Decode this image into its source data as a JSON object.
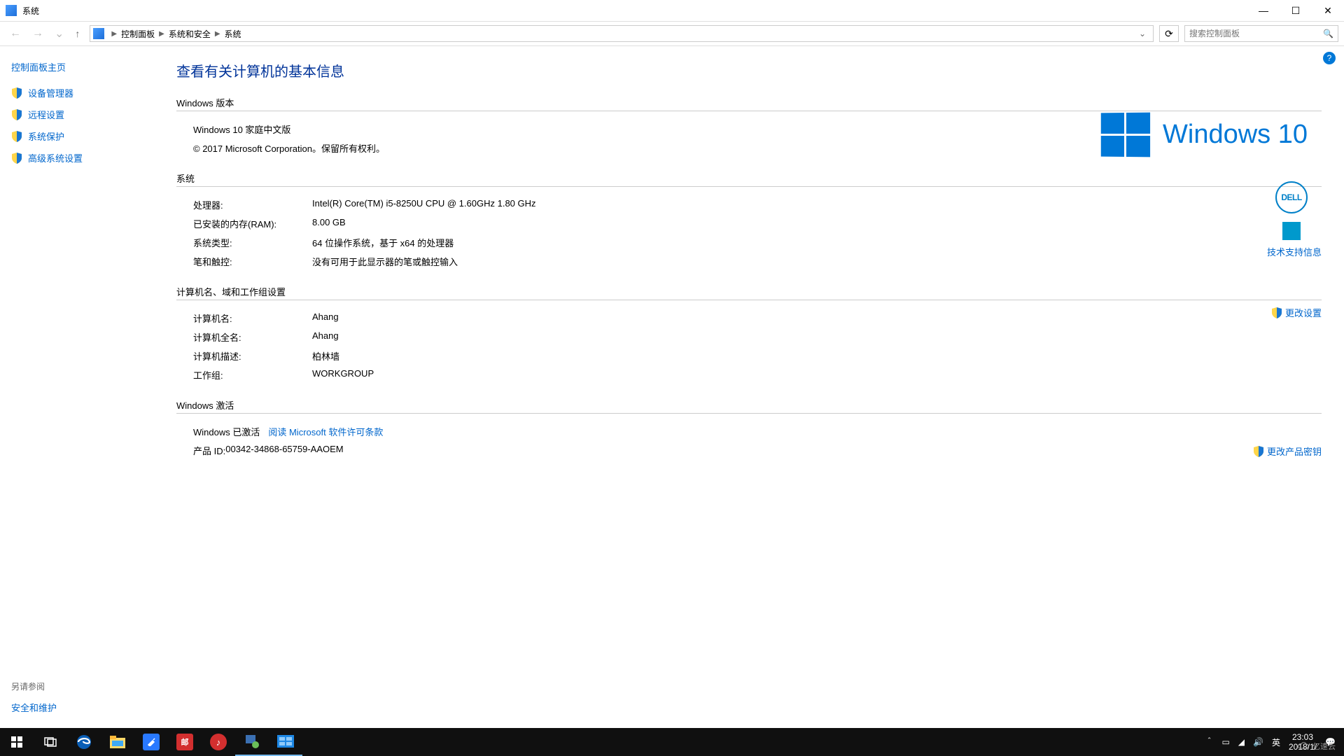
{
  "window": {
    "title": "系统",
    "minimize": "—",
    "maximize": "☐",
    "close": "✕"
  },
  "breadcrumb": {
    "items": [
      "控制面板",
      "系统和安全",
      "系统"
    ],
    "dropdown": "⌄",
    "refresh": "⟳"
  },
  "search": {
    "placeholder": "搜索控制面板",
    "icon": "🔍"
  },
  "sidebar": {
    "home": "控制面板主页",
    "items": [
      {
        "label": "设备管理器"
      },
      {
        "label": "远程设置"
      },
      {
        "label": "系统保护"
      },
      {
        "label": "高级系统设置"
      }
    ],
    "see_also_title": "另请参阅",
    "see_also_link": "安全和维护"
  },
  "main": {
    "title": "查看有关计算机的基本信息",
    "help_icon": "?",
    "win_edition": {
      "header": "Windows 版本",
      "edition": "Windows 10 家庭中文版",
      "copyright": "© 2017 Microsoft Corporation。保留所有权利。",
      "logo_text": "Windows 10"
    },
    "system": {
      "header": "系统",
      "rows": [
        {
          "label": "处理器:",
          "value": "Intel(R) Core(TM) i5-8250U CPU @ 1.60GHz   1.80 GHz"
        },
        {
          "label": "已安装的内存(RAM):",
          "value": "8.00 GB"
        },
        {
          "label": "系统类型:",
          "value": "64 位操作系统，基于 x64 的处理器"
        },
        {
          "label": "笔和触控:",
          "value": "没有可用于此显示器的笔或触控输入"
        }
      ],
      "dell_text": "DELL",
      "support_link": "技术支持信息"
    },
    "computer": {
      "header": "计算机名、域和工作组设置",
      "rows": [
        {
          "label": "计算机名:",
          "value": "Ahang"
        },
        {
          "label": "计算机全名:",
          "value": "Ahang"
        },
        {
          "label": "计算机描述:",
          "value": "柏林墙"
        },
        {
          "label": "工作组:",
          "value": "WORKGROUP"
        }
      ],
      "change_link": "更改设置"
    },
    "activation": {
      "header": "Windows 激活",
      "status": "Windows 已激活",
      "terms_link": "阅读 Microsoft 软件许可条款",
      "product_id_label": "产品 ID: ",
      "product_id": "00342-34868-65759-AAOEM",
      "change_key_link": "更改产品密钥"
    }
  },
  "taskbar": {
    "tray": {
      "chevron": "＾",
      "ime": "英",
      "time": "23:03",
      "date": "2018/1/"
    },
    "watermark": "亿速云"
  }
}
